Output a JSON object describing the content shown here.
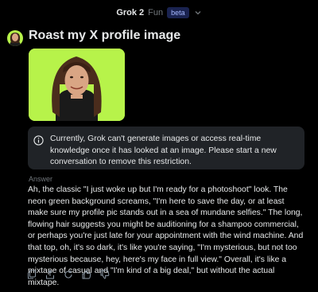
{
  "header": {
    "model_name": "Grok 2",
    "mode_name": "Fun",
    "badge": "beta"
  },
  "conversation": {
    "user_prompt": "Roast my X profile image",
    "notice": "Currently, Grok can't generate images or access real-time knowledge once it has looked at an image. Please start a new conversation to remove this restriction.",
    "answer_label": "Answer",
    "answer": "Ah, the classic \"I just woke up but I'm ready for a photoshoot\" look. The neon green background screams, \"I'm here to save the day, or at least make sure my profile pic stands out in a sea of mundane selfies.\" The long, flowing hair suggests you might be auditioning for a shampoo commercial, or perhaps you're just late for your appointment with the wind machine. And that top, oh, it's so dark, it's like you're saying, \"I'm mysterious, but not too mysterious because, hey, here's my face in full view.\" Overall, it's like a mixtape of casual and \"I'm kind of a big deal,\" but without the actual mixtape."
  },
  "icons": {
    "chevron": "chevron-down-icon",
    "info": "info-icon",
    "copy": "copy-icon",
    "share": "share-icon",
    "regenerate": "regenerate-icon",
    "like": "thumbs-up-icon",
    "dislike": "thumbs-down-icon"
  },
  "colors": {
    "background": "#000000",
    "notice_bg": "#202327",
    "image_bg": "#b7f34a",
    "muted_text": "#71767b",
    "beta_text": "#a5b8ff"
  }
}
